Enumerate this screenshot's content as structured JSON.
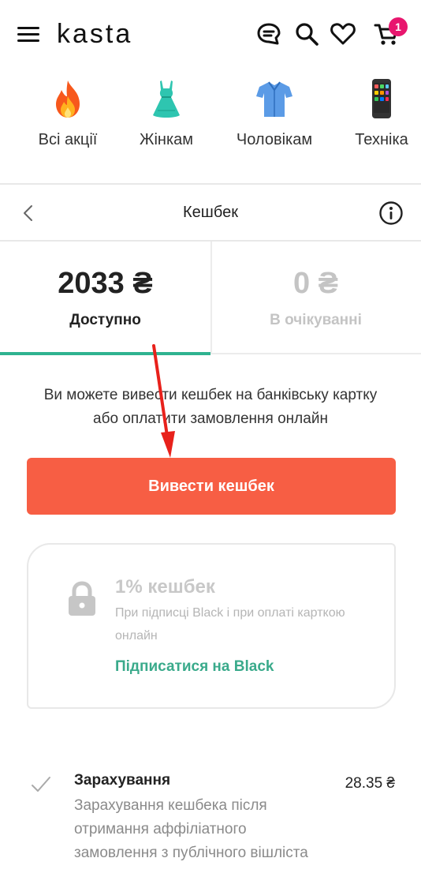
{
  "header": {
    "logo": "kasta",
    "cart_count": "1"
  },
  "categories": [
    {
      "label": "Всі акції",
      "icon": "fire-icon"
    },
    {
      "label": "Жінкам",
      "icon": "dress-icon"
    },
    {
      "label": "Чоловікам",
      "icon": "shirt-icon"
    },
    {
      "label": "Техніка",
      "icon": "phone-icon"
    }
  ],
  "page": {
    "title": "Кешбек"
  },
  "tabs": [
    {
      "amount": "2033 ₴",
      "caption": "Доступно"
    },
    {
      "amount": "0 ₴",
      "caption": "В очікуванні"
    }
  ],
  "description": "Ви можете вивести кешбек на банківську картку або оплатити замовлення онлайн",
  "withdraw_button": "Вивести кешбек",
  "promo_card": {
    "title": "1% кешбек",
    "subtitle": "При підписці Black і при оплаті карткою онлайн",
    "link": "Підписатися на Black"
  },
  "transaction": {
    "title": "Зарахування",
    "description": "Зарахування кешбека після отримання аффіліатного замовлення з публічного вішліста",
    "amount": "28.35 ₴"
  },
  "colors": {
    "accent_orange": "#f75e44",
    "accent_green": "#2fb390",
    "badge_pink": "#e8166e"
  }
}
